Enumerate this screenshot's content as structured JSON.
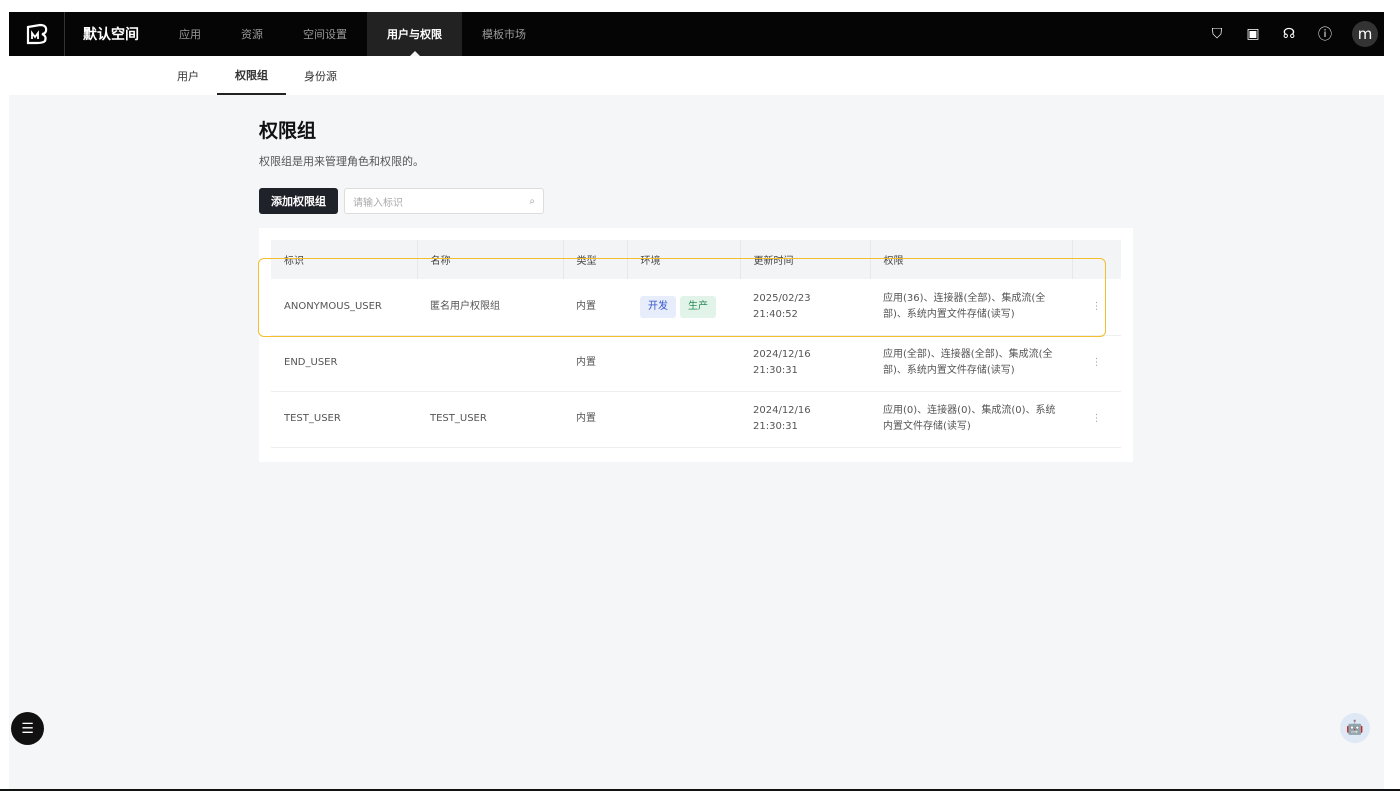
{
  "topbar": {
    "workspace": "默认空间",
    "nav": [
      "应用",
      "资源",
      "空间设置",
      "用户与权限",
      "模板市场"
    ],
    "active_index": 3,
    "avatar": "m"
  },
  "subnav": {
    "tabs": [
      "用户",
      "权限组",
      "身份源"
    ],
    "active_index": 1
  },
  "page": {
    "title": "权限组",
    "description": "权限组是用来管理角色和权限的。",
    "add_button": "添加权限组",
    "search_placeholder": "请输入标识"
  },
  "table": {
    "headers": [
      "标识",
      "名称",
      "类型",
      "环境",
      "更新时间",
      "权限"
    ],
    "rows": [
      {
        "id": "ANONYMOUS_USER",
        "name": "匿名用户权限组",
        "type": "内置",
        "env": [
          "开发",
          "生产"
        ],
        "date": "2025/02/23",
        "time": "21:40:52",
        "perm1": "应用(36)、连接器(全部)、集成流(全",
        "perm2": "部)、系统内置文件存储(读写)"
      },
      {
        "id": "END_USER",
        "name": "",
        "type": "内置",
        "env": [],
        "date": "2024/12/16",
        "time": "21:30:31",
        "perm1": "应用(全部)、连接器(全部)、集成流(全",
        "perm2": "部)、系统内置文件存储(读写)"
      },
      {
        "id": "TEST_USER",
        "name": "TEST_USER",
        "type": "内置",
        "env": [],
        "date": "2024/12/16",
        "time": "21:30:31",
        "perm1": "应用(0)、连接器(0)、集成流(0)、系统",
        "perm2": "内置文件存储(读写)"
      }
    ]
  },
  "colors": {
    "dev_bg": "#e8edfc",
    "dev_fg": "#3355cc",
    "prod_bg": "#e2f4ea",
    "prod_fg": "#2a8a55",
    "highlight": "#f4be2d"
  }
}
